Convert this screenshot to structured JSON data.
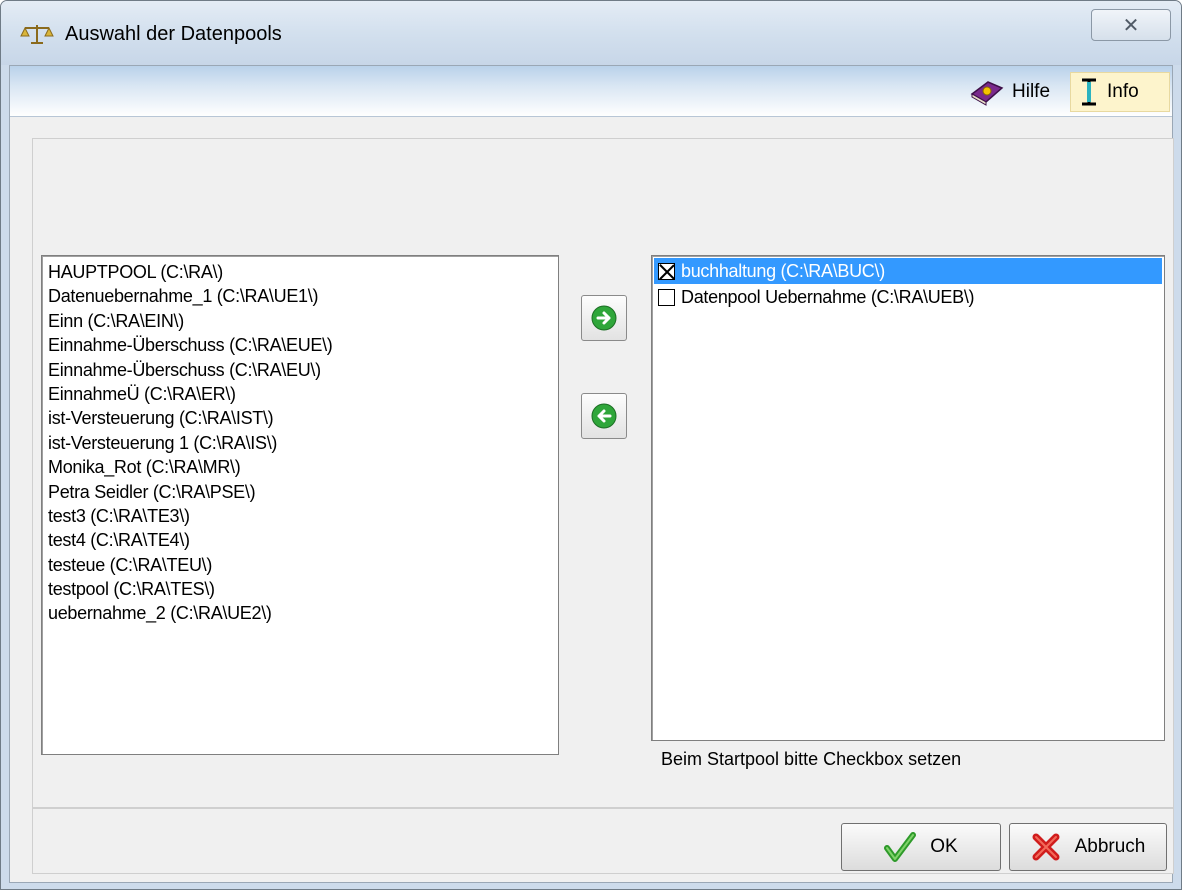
{
  "window": {
    "title": "Auswahl der Datenpools",
    "close_label": "✕"
  },
  "toolbar": {
    "hilfe_label": "Hilfe",
    "info_label": "Info"
  },
  "available_pools": [
    "HAUPTPOOL (C:\\RA\\)",
    "Datenuebernahme_1 (C:\\RA\\UE1\\)",
    "Einn (C:\\RA\\EIN\\)",
    "Einnahme-Überschuss (C:\\RA\\EUE\\)",
    "Einnahme-Überschuss (C:\\RA\\EU\\)",
    "EinnahmeÜ (C:\\RA\\ER\\)",
    "ist-Versteuerung (C:\\RA\\IST\\)",
    "ist-Versteuerung 1 (C:\\RA\\IS\\)",
    "Monika_Rot  (C:\\RA\\MR\\)",
    "Petra Seidler (C:\\RA\\PSE\\)",
    "test3 (C:\\RA\\TE3\\)",
    "test4 (C:\\RA\\TE4\\)",
    "testeue (C:\\RA\\TEU\\)",
    "testpool (C:\\RA\\TES\\)",
    "uebernahme_2 (C:\\RA\\UE2\\)"
  ],
  "selected_pools": [
    {
      "label": "buchhaltung (C:\\RA\\BUC\\)",
      "checked": true,
      "selected": true
    },
    {
      "label": "Datenpool Uebernahme (C:\\RA\\UEB\\)",
      "checked": false,
      "selected": false
    }
  ],
  "hint": "Beim Startpool bitte Checkbox setzen",
  "buttons": {
    "ok_label": "OK",
    "cancel_label": "Abbruch"
  },
  "colors": {
    "selection": "#3399ff",
    "arrow_green": "#2fa63a",
    "ok_check": "#2e9a2a",
    "cancel_x": "#d01c1c"
  }
}
